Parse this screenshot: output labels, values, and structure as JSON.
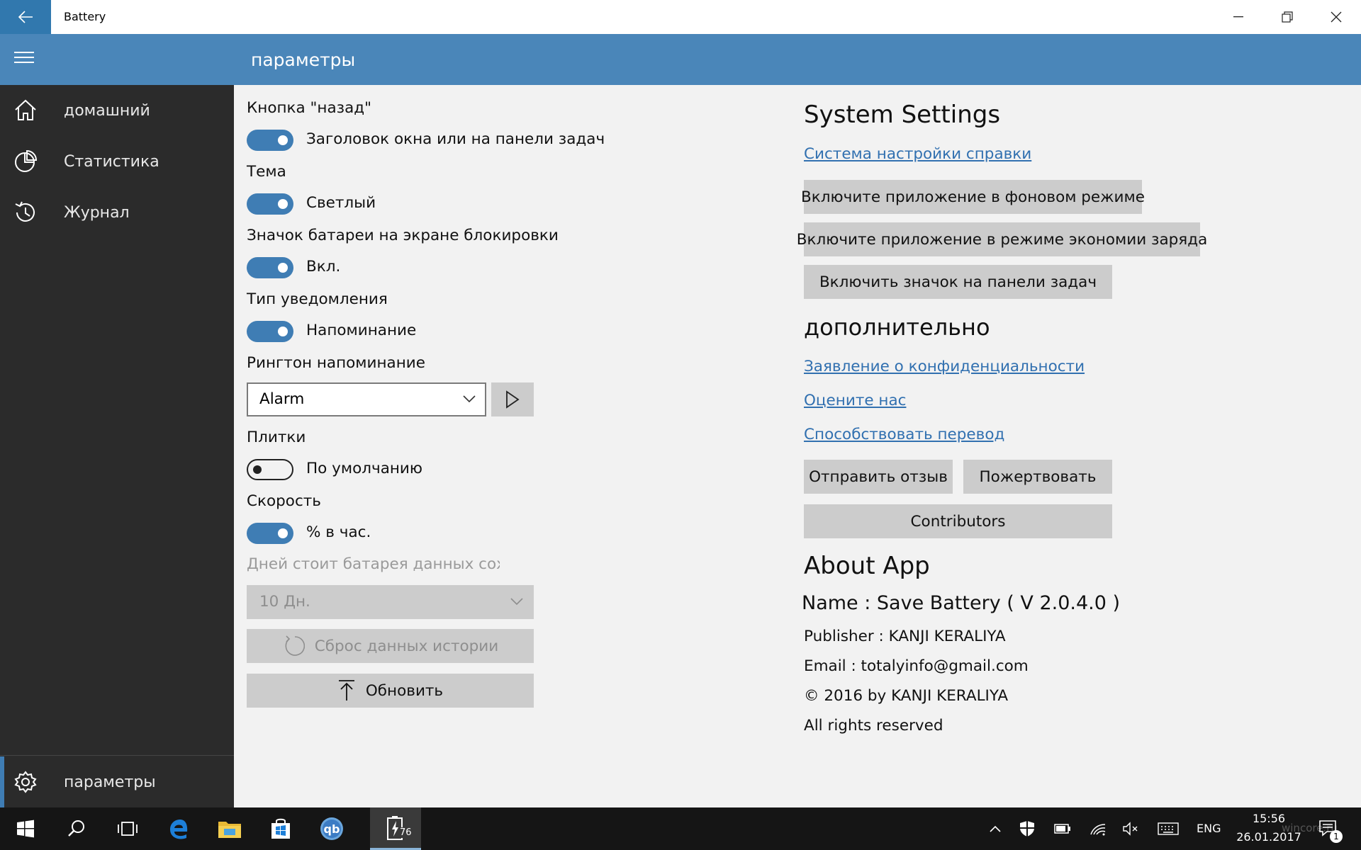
{
  "window": {
    "title": "Battery"
  },
  "header": {
    "page_title": "параметры"
  },
  "sidebar": {
    "items": [
      {
        "label": "домашний",
        "icon": "home-icon"
      },
      {
        "label": "Статистика",
        "icon": "pie-chart-icon"
      },
      {
        "label": "Журнал",
        "icon": "history-icon"
      }
    ],
    "footer": {
      "label": "параметры",
      "icon": "gear-icon"
    }
  },
  "settings": {
    "back_button": {
      "label": "Кнопка \"назад\"",
      "toggle_text": "Заголовок окна или на панели задач",
      "on": true
    },
    "theme": {
      "label": "Тема",
      "toggle_text": "Светлый",
      "on": true
    },
    "lock_badge": {
      "label": "Значок батареи на экране блокировки",
      "toggle_text": "Вкл.",
      "on": true
    },
    "notification": {
      "label": "Тип уведомления",
      "toggle_text": "Напоминание",
      "on": true
    },
    "ringtone": {
      "label": "Рингтон напоминание",
      "selected": "Alarm"
    },
    "tiles": {
      "label": "Плитки",
      "toggle_text": "По умолчанию",
      "on": false
    },
    "speed": {
      "label": "Скорость",
      "toggle_text": "% в час.",
      "on": true
    },
    "history_days": {
      "label": "Дней стоит батарея данных сохра",
      "selected": "10 Дн."
    },
    "reset_label": "Сброс данных истории",
    "update_label": "Обновить"
  },
  "system": {
    "heading": "System Settings",
    "help_link": "Система настройки справки",
    "bg_button": "Включите приложение в фоновом режиме",
    "saver_button": "Включите приложение в режиме экономии заряда",
    "taskbar_button": "Включить значок на панели задач"
  },
  "extra": {
    "heading": "дополнительно",
    "privacy_link": "Заявление о конфиденциальности",
    "rate_link": "Оцените нас",
    "translate_link": "Способствовать перевод",
    "feedback_button": "Отправить отзыв",
    "donate_button": "Пожертвовать",
    "contributors_button": "Contributors"
  },
  "about": {
    "heading": "About App",
    "name": "Name : Save Battery  ( V 2.0.4.0 )",
    "publisher": "Publisher : KANJI KERALIYA",
    "email": "Email :  totalyinfo@gmail.com",
    "copyright": "© 2016 by KANJI KERALIYA",
    "rights": "All rights reserved"
  },
  "taskbar": {
    "battery_badge": "76",
    "lang": "ENG",
    "time": "15:56",
    "date": "26.01.2017",
    "notification_count": "1",
    "watermark": "wincore.ru"
  },
  "colors": {
    "accent": "#4a86b9",
    "sidebar": "#2b2b2b",
    "link": "#3170b0",
    "button": "#cccccc"
  }
}
